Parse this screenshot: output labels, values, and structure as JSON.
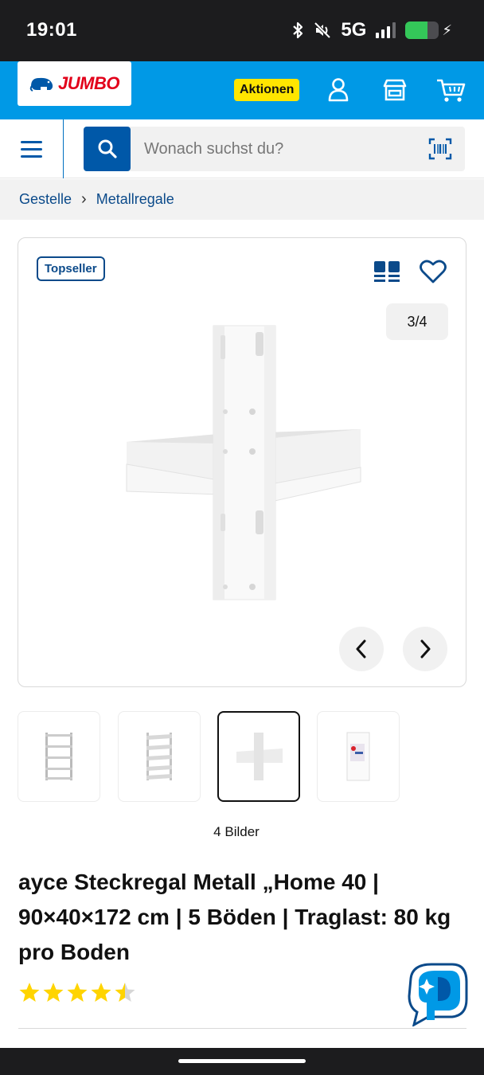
{
  "status_bar": {
    "time": "19:01",
    "network": "5G",
    "battery_percent": 65
  },
  "header": {
    "brand": "JUMBO",
    "promo_label": "Aktionen",
    "colors": {
      "primary": "#0099e6",
      "promo": "#ffe600",
      "brand_red": "#e2001a"
    }
  },
  "search": {
    "placeholder": "Wonach suchst du?"
  },
  "breadcrumb": {
    "items": [
      "Gestelle",
      "Metallregale"
    ]
  },
  "product": {
    "badge": "Topseller",
    "image_counter": "3/4",
    "image_count_label": "4 Bilder",
    "title": "ayce Steckregal Metall „Home 40 | 90×40×172 cm | 5 Böden | Traglast: 80 kg pro Boden",
    "rating": 4.5,
    "rating_max": 5
  },
  "thumbnails": [
    {
      "icon": "shelf-assembled-icon",
      "active": false
    },
    {
      "icon": "shelf-side-view-icon",
      "active": false
    },
    {
      "icon": "shelf-detail-icon",
      "active": true
    },
    {
      "icon": "package-box-icon",
      "active": false
    }
  ]
}
